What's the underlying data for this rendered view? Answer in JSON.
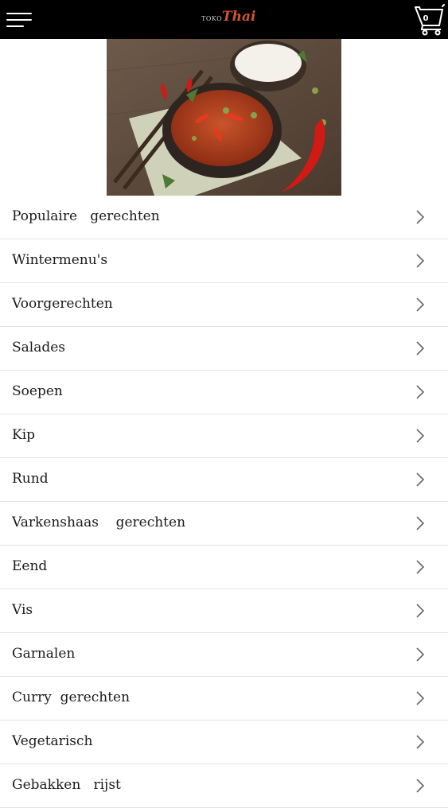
{
  "header": {
    "menu_icon": "hamburger-menu-icon",
    "logo_small_text": "TOKO",
    "logo_script_text": "Thai",
    "cart_icon": "shopping-cart-icon",
    "cart_count": "0",
    "background": "#000000",
    "logo_accent": "#d2552b"
  },
  "hero": {
    "image_icon": "thai-curry-dish-image"
  },
  "categories": [
    {
      "label": "Populaire   gerechten"
    },
    {
      "label": "Wintermenu's"
    },
    {
      "label": "Voorgerechten"
    },
    {
      "label": "Salades"
    },
    {
      "label": "Soepen"
    },
    {
      "label": "Kip"
    },
    {
      "label": "Rund"
    },
    {
      "label": "Varkenshaas    gerechten"
    },
    {
      "label": "Eend"
    },
    {
      "label": "Vis"
    },
    {
      "label": "Garnalen"
    },
    {
      "label": "Curry  gerechten"
    },
    {
      "label": "Vegetarisch"
    },
    {
      "label": "Gebakken   rijst"
    }
  ],
  "chevron_icon": "chevron-right-icon"
}
